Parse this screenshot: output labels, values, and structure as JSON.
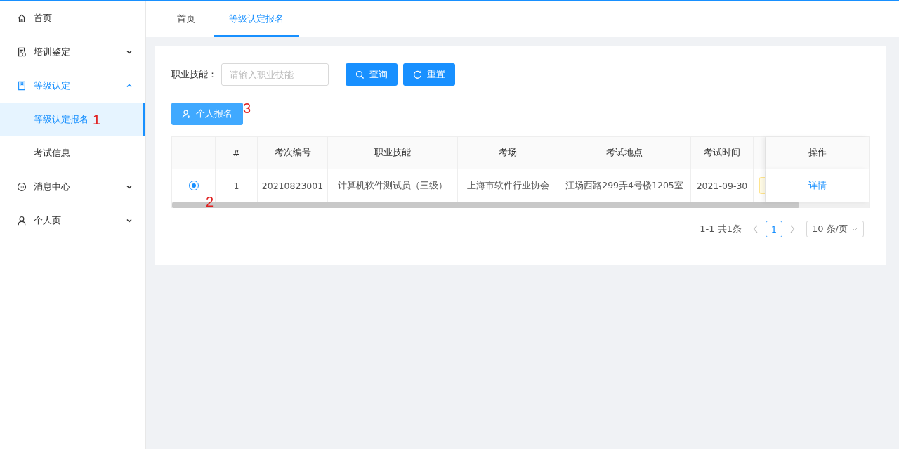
{
  "sidebar": {
    "items": [
      {
        "label": "首页",
        "selected": false
      },
      {
        "label": "培训鉴定",
        "selected": false,
        "expanded": false
      },
      {
        "label": "等级认定",
        "selected": true,
        "expanded": true,
        "children": [
          {
            "label": "等级认定报名",
            "selected": true,
            "annotation": "1"
          },
          {
            "label": "考试信息",
            "selected": false
          }
        ]
      },
      {
        "label": "消息中心",
        "selected": false,
        "expanded": false
      },
      {
        "label": "个人页",
        "selected": false,
        "expanded": false
      }
    ]
  },
  "tabs": [
    {
      "label": "首页",
      "selected": false
    },
    {
      "label": "等级认定报名",
      "selected": true
    }
  ],
  "search": {
    "label": "职业技能：",
    "placeholder": "请输入职业技能",
    "buttons": [
      "查询",
      "重置"
    ]
  },
  "register_button": {
    "label": "个人报名",
    "annotation": "3"
  },
  "table": {
    "columns": [
      "#",
      "考次编号",
      "职业技能",
      "考场",
      "考试地点",
      "考试时间",
      "操作"
    ],
    "rows": [
      {
        "selected": true,
        "annotation": "2",
        "cells": [
          "1",
          "20210823001",
          "计算机软件测试员（三级）",
          "上海市软件行业协会",
          "江场西路299弄4号楼1205室",
          "2021-09-30"
        ],
        "action": "详情"
      }
    ]
  },
  "pagination": {
    "summary": "1-1 共1条",
    "pages": [
      {
        "label": "1",
        "selected": true
      }
    ],
    "page_size": "10 条/页"
  }
}
